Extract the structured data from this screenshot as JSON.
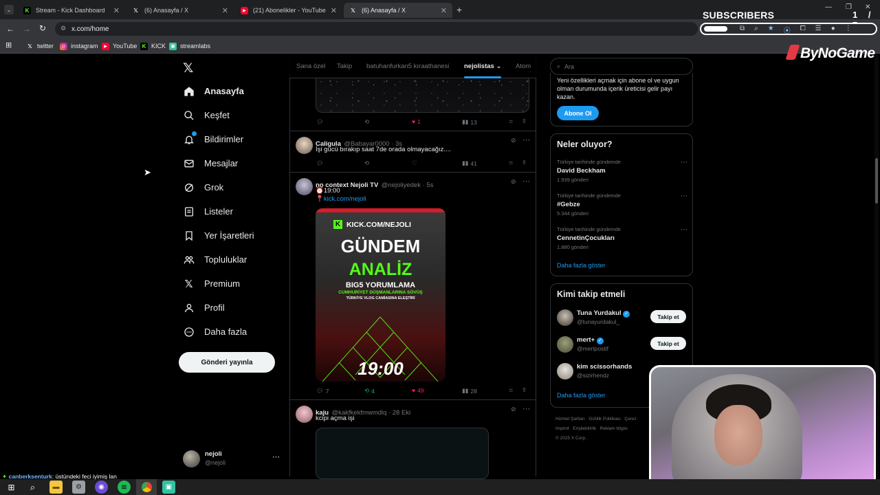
{
  "browser": {
    "tabs": [
      {
        "label": "Stream - Kick Dashboard",
        "icon": "kick-icon"
      },
      {
        "label": "(6) Anasayfa / X",
        "icon": "x-icon"
      },
      {
        "label": "(21) Abonelikler - YouTube",
        "icon": "youtube-icon"
      },
      {
        "label": "(6) Anasayfa / X",
        "icon": "x-icon",
        "active": true
      }
    ],
    "url": "x.com/home",
    "bookmarks": [
      {
        "label": "twitter",
        "icon": "x-icon"
      },
      {
        "label": "instagram",
        "icon": "instagram-icon"
      },
      {
        "label": "YouTube",
        "icon": "youtube-icon"
      },
      {
        "label": "KICK",
        "icon": "kick-icon"
      },
      {
        "label": "streamlabs",
        "icon": "streamlabs-icon"
      }
    ]
  },
  "overlay": {
    "subscribers_label": "SUBSCRIBERS",
    "count": "1 / 7",
    "progress_fraction": 0.14,
    "brand": "ByNoGame"
  },
  "nav": {
    "items": [
      {
        "label": "Anasayfa",
        "icon": "home-icon",
        "active": true
      },
      {
        "label": "Keşfet",
        "icon": "search-icon"
      },
      {
        "label": "Bildirimler",
        "icon": "bell-icon"
      },
      {
        "label": "Mesajlar",
        "icon": "mail-icon"
      },
      {
        "label": "Grok",
        "icon": "grok-icon"
      },
      {
        "label": "Listeler",
        "icon": "list-icon"
      },
      {
        "label": "Yer İşaretleri",
        "icon": "bookmark-icon"
      },
      {
        "label": "Topluluklar",
        "icon": "communities-icon"
      },
      {
        "label": "Premium",
        "icon": "x-icon"
      },
      {
        "label": "Profil",
        "icon": "person-icon"
      },
      {
        "label": "Daha fazla",
        "icon": "more-circle-icon"
      }
    ],
    "post_button": "Gönderi yayınla",
    "account": {
      "name": "nejoli",
      "handle": "@nejoli"
    }
  },
  "feed": {
    "tabs": [
      "Sana özel",
      "Takip",
      "batuhanfurkan5 kıraathanesi",
      "nejolistas",
      "Atom"
    ],
    "active_tab": "nejolistas",
    "tweet0_actions": {
      "likes": "1",
      "views": "13"
    },
    "tweets": [
      {
        "name": "Caligula",
        "handle": "@Babayar0000 · 3s",
        "text": "İşi gücü bırakıp saat 7de orada olmayacağız....",
        "views": "41"
      },
      {
        "name": "no context Nejoli TV",
        "handle": "@nejoliyedek · 5s",
        "line1": "⏰19:00",
        "line2_prefix": "📍",
        "link": "kick.com/nejoli",
        "image": {
          "url_text": "KICK.COM/NEJOLI",
          "title1": "GÜNDEM",
          "title2": "ANALİZ",
          "subtitle": "BIG5 YORUMLAMA",
          "line_a": "CUMHURİYET DÜŞMANLARINA SÖVÜŞ",
          "line_b": "TÜRKİYE VLOG CAMİASINA ELEŞTİRİ",
          "time": "19:00"
        },
        "replies": "7",
        "reposts": "4",
        "likes": "49",
        "views": "28"
      },
      {
        "name": "kaju",
        "handle": "@kakfkekfmwmdlq · 28 Eki",
        "text": "kcipi açma işi"
      }
    ]
  },
  "sidebar": {
    "search_placeholder": "Ara",
    "premium_text": "Yeni özellikleri açmak için abone ol ve uygun olman durumunda içerik üreticisi gelir payı kazan.",
    "subscribe_button": "Abone Ol",
    "trends_title": "Neler oluyor?",
    "trends": [
      {
        "context": "Türkiye tarihinde gündemde",
        "name": "David Beckham",
        "count": "1.939 gönderi"
      },
      {
        "context": "Türkiye tarihinde gündemde",
        "name": "#Gebze",
        "count": "5.344 gönderi"
      },
      {
        "context": "Türkiye tarihinde gündemde",
        "name": "CennetinÇocukları",
        "count": "1.880 gönderi"
      }
    ],
    "show_more": "Daha fazla göster",
    "who_to_follow_title": "Kimi takip etmeli",
    "follow_suggestions": [
      {
        "name": "Tuna Yurdakul",
        "handle": "@tunayurdakul_",
        "verified": true,
        "button": "Takip et"
      },
      {
        "name": "mert+",
        "handle": "@mertpostif",
        "verified": true,
        "button": "Takip et"
      },
      {
        "name": "kim scissorhands",
        "handle": "@sizirhendz",
        "verified": false,
        "button": ""
      }
    ],
    "footer_line1": "Hizmet Şartları   Gizlilik Politikası   Çerez",
    "footer_line2": "Imprint   Erişilebilirlik   Reklam bilgisi",
    "footer_line3": "© 2025 X Corp."
  },
  "chat": {
    "user": "canberksenturk",
    "message": ": üstündeki feci iyimiş lan"
  }
}
